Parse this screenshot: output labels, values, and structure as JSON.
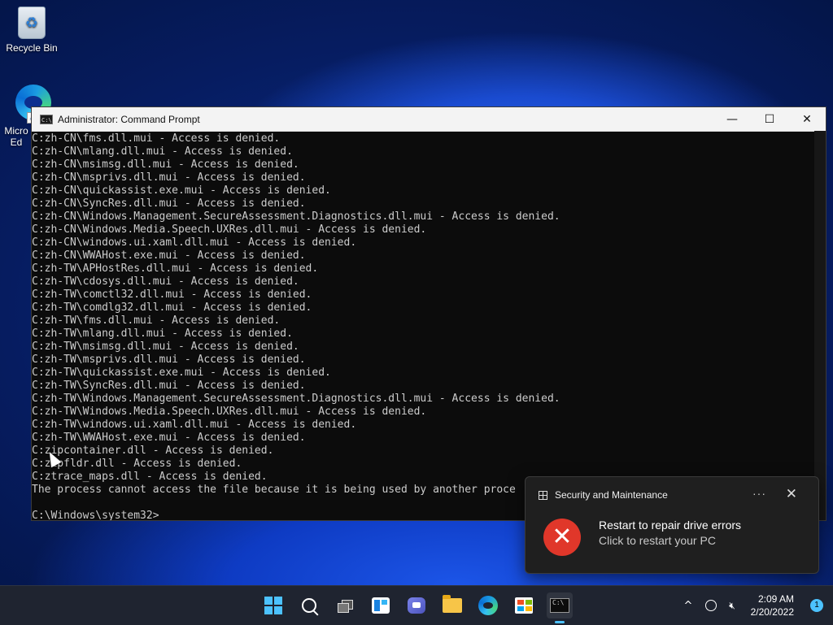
{
  "desktop": {
    "recycle_bin_label": "Recycle Bin",
    "edge_label": "Micro Ed"
  },
  "window": {
    "title": "Administrator: Command Prompt",
    "minimize_symbol": "—",
    "maximize_symbol": "☐",
    "close_symbol": "✕",
    "lines": [
      "C:zh-CN\\fms.dll.mui - Access is denied.",
      "C:zh-CN\\mlang.dll.mui - Access is denied.",
      "C:zh-CN\\msimsg.dll.mui - Access is denied.",
      "C:zh-CN\\msprivs.dll.mui - Access is denied.",
      "C:zh-CN\\quickassist.exe.mui - Access is denied.",
      "C:zh-CN\\SyncRes.dll.mui - Access is denied.",
      "C:zh-CN\\Windows.Management.SecureAssessment.Diagnostics.dll.mui - Access is denied.",
      "C:zh-CN\\Windows.Media.Speech.UXRes.dll.mui - Access is denied.",
      "C:zh-CN\\windows.ui.xaml.dll.mui - Access is denied.",
      "C:zh-CN\\WWAHost.exe.mui - Access is denied.",
      "C:zh-TW\\APHostRes.dll.mui - Access is denied.",
      "C:zh-TW\\cdosys.dll.mui - Access is denied.",
      "C:zh-TW\\comctl32.dll.mui - Access is denied.",
      "C:zh-TW\\comdlg32.dll.mui - Access is denied.",
      "C:zh-TW\\fms.dll.mui - Access is denied.",
      "C:zh-TW\\mlang.dll.mui - Access is denied.",
      "C:zh-TW\\msimsg.dll.mui - Access is denied.",
      "C:zh-TW\\msprivs.dll.mui - Access is denied.",
      "C:zh-TW\\quickassist.exe.mui - Access is denied.",
      "C:zh-TW\\SyncRes.dll.mui - Access is denied.",
      "C:zh-TW\\Windows.Management.SecureAssessment.Diagnostics.dll.mui - Access is denied.",
      "C:zh-TW\\Windows.Media.Speech.UXRes.dll.mui - Access is denied.",
      "C:zh-TW\\windows.ui.xaml.dll.mui - Access is denied.",
      "C:zh-TW\\WWAHost.exe.mui - Access is denied.",
      "C:zipcontainer.dll - Access is denied.",
      "C:zipfldr.dll - Access is denied.",
      "C:ztrace_maps.dll - Access is denied.",
      "The process cannot access the file because it is being used by another proce",
      "",
      "C:\\Windows\\system32>"
    ]
  },
  "toast": {
    "app_name": "Security and Maintenance",
    "more_symbol": "···",
    "close_symbol": "✕",
    "error_symbol": "✕",
    "title": "Restart to repair drive errors",
    "body": "Click to restart your PC"
  },
  "taskbar": {
    "time": "2:09 AM",
    "date": "2/20/2022",
    "notification_count": "1",
    "tray_chevron": "^",
    "accent_color": "#4cc2ff"
  }
}
